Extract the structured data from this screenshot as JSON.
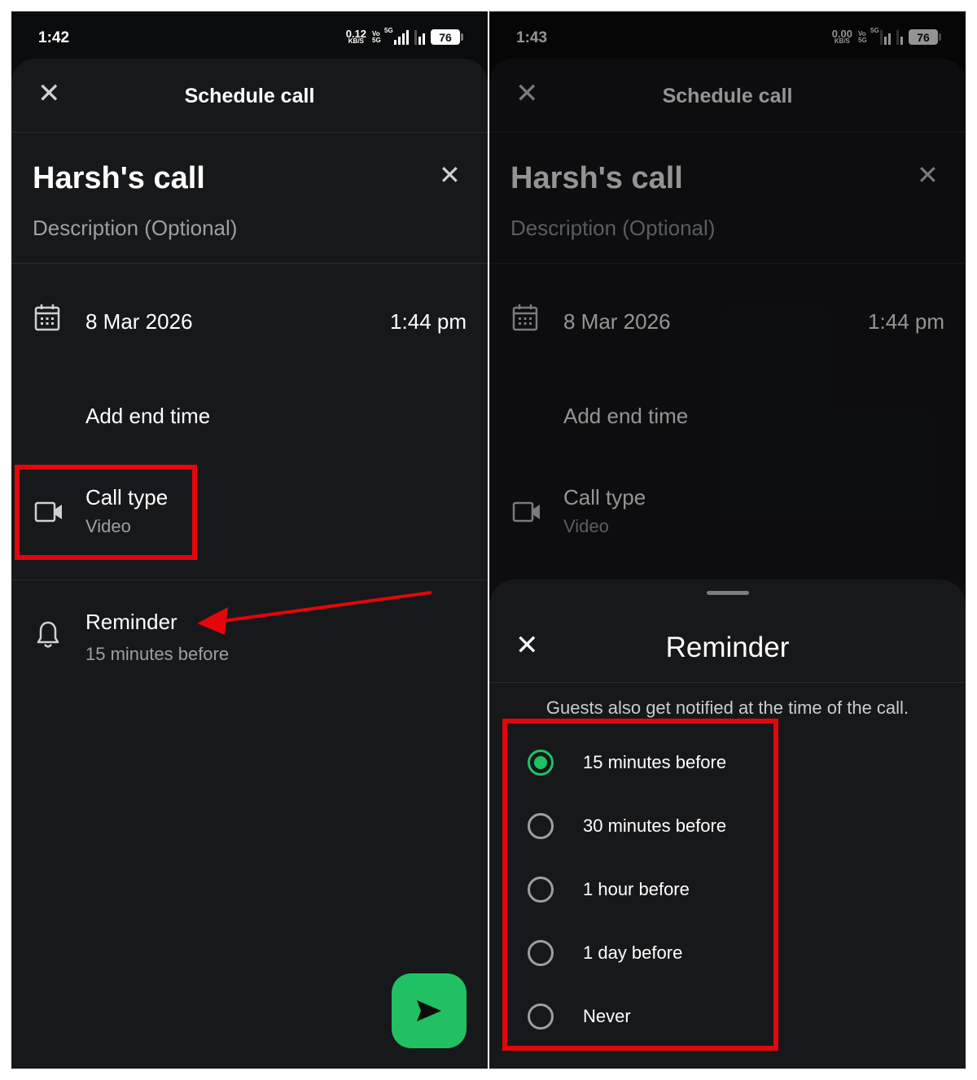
{
  "left": {
    "status": {
      "time": "1:42",
      "net_value": "0.12",
      "net_unit": "KB/S",
      "volte": "Vo 5G",
      "net_type": "5G",
      "battery": "76"
    },
    "header": {
      "title": "Schedule call"
    },
    "call": {
      "name": "Harsh's call",
      "description_placeholder": "Description (Optional)"
    },
    "date": "8 Mar 2026",
    "time": "1:44 pm",
    "end_time_label": "Add end time",
    "call_type": {
      "label": "Call type",
      "value": "Video"
    },
    "reminder": {
      "label": "Reminder",
      "value": "15 minutes before"
    }
  },
  "right": {
    "status": {
      "time": "1:43",
      "net_value": "0.00",
      "net_unit": "KB/S",
      "volte": "Vo 5G",
      "net_type": "5G",
      "battery": "76"
    },
    "header": {
      "title": "Schedule call"
    },
    "call": {
      "name": "Harsh's call",
      "description_placeholder": "Description (Optional)"
    },
    "date": "8 Mar 2026",
    "time": "1:44 pm",
    "end_time_label": "Add end time",
    "call_type": {
      "label": "Call type",
      "value": "Video"
    },
    "reminder_sheet": {
      "title": "Reminder",
      "note": "Guests also get notified at the time of the call.",
      "selected_index": 0,
      "options": [
        "15 minutes before",
        "30 minutes before",
        "1 hour before",
        "1 day before",
        "Never"
      ]
    }
  },
  "colors": {
    "accent": "#21c063",
    "highlight": "#e3060b",
    "background": "#17181a"
  },
  "icons": {
    "close": "close-icon",
    "calendar": "calendar-icon",
    "video": "video-camera-icon",
    "bell": "bell-icon",
    "send": "send-icon"
  }
}
